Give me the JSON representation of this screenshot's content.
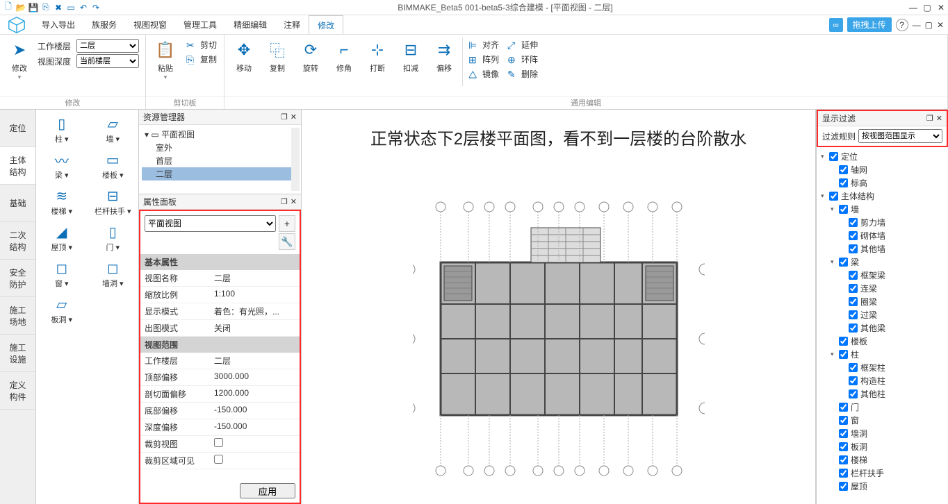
{
  "title": "BIMMAKE_Beta5 001-beta5-3综合建模 - [平面视图 - 二层]",
  "menus": [
    "导入导出",
    "族服务",
    "视图视窗",
    "管理工具",
    "精细编辑",
    "注释",
    "修改"
  ],
  "active_menu": "修改",
  "upload_label": "拖拽上传",
  "ribbon": {
    "modify": {
      "label": "修改",
      "tool": "修改",
      "work_floor_label": "工作楼层",
      "work_floor_value": "二层",
      "view_depth_label": "视图深度",
      "view_depth_value": "当前楼层"
    },
    "clipboard": {
      "label": "剪切板",
      "paste": "粘贴",
      "cut": "剪切",
      "copy": "复制"
    },
    "edit": {
      "label": "通用编辑",
      "move": "移动",
      "copy2": "复制",
      "rotate": "旋转",
      "corner": "修角",
      "break": "打断",
      "trim": "扣减",
      "offset": "偏移",
      "align": "对齐",
      "array": "阵列",
      "mirror": "镜像",
      "extend": "延伸",
      "ring": "环阵",
      "delete": "删除"
    }
  },
  "left_tabs": [
    "定位",
    "主体\n结构",
    "基础",
    "二次\n结构",
    "安全\n防护",
    "施工\n场地",
    "施工\n设施",
    "定义\n构件"
  ],
  "active_left_tab": 1,
  "palette": [
    {
      "icon": "▯",
      "label": "柱"
    },
    {
      "icon": "▱",
      "label": "墙"
    },
    {
      "icon": "〰",
      "label": "梁"
    },
    {
      "icon": "▭",
      "label": "楼板"
    },
    {
      "icon": "≋",
      "label": "楼梯"
    },
    {
      "icon": "⊟",
      "label": "栏杆扶手"
    },
    {
      "icon": "◢",
      "label": "屋顶"
    },
    {
      "icon": "▯",
      "label": "门"
    },
    {
      "icon": "◻",
      "label": "窗"
    },
    {
      "icon": "◻",
      "label": "墙洞"
    },
    {
      "icon": "▱",
      "label": "板洞"
    },
    {
      "icon": "",
      "label": ""
    }
  ],
  "browser": {
    "title": "资源管理器",
    "root": "平面视图",
    "items": [
      "室外",
      "首层",
      "二层"
    ],
    "selected": "二层"
  },
  "props": {
    "title": "属性面板",
    "type": "平面视图",
    "basic_label": "基本属性",
    "basic": [
      {
        "k": "视图名称",
        "v": "二层"
      },
      {
        "k": "缩放比例",
        "v": "1:100"
      },
      {
        "k": "显示模式",
        "v": "着色：有光照，..."
      },
      {
        "k": "出图模式",
        "v": "关闭"
      }
    ],
    "range_label": "视图范围",
    "range": [
      {
        "k": "工作楼层",
        "v": "二层"
      },
      {
        "k": "顶部偏移",
        "v": "3000.000"
      },
      {
        "k": "剖切面偏移",
        "v": "1200.000"
      },
      {
        "k": "底部偏移",
        "v": "-150.000"
      },
      {
        "k": "深度偏移",
        "v": "-150.000"
      },
      {
        "k": "裁剪视图",
        "v": "",
        "cb": true
      },
      {
        "k": "裁剪区域可见",
        "v": "",
        "cb": true
      }
    ],
    "apply": "应用"
  },
  "annotation": "正常状态下2层楼平面图，看不到一层楼的台阶散水",
  "filter": {
    "title": "显示过滤",
    "rule_label": "过滤规则",
    "rule_value": "按视图范围显示",
    "tree": [
      {
        "d": 0,
        "a": "▾",
        "t": "定位"
      },
      {
        "d": 1,
        "t": "轴网"
      },
      {
        "d": 1,
        "t": "标高"
      },
      {
        "d": 0,
        "a": "▾",
        "t": "主体结构"
      },
      {
        "d": 1,
        "a": "▾",
        "t": "墙"
      },
      {
        "d": 2,
        "t": "剪力墙"
      },
      {
        "d": 2,
        "t": "砌体墙"
      },
      {
        "d": 2,
        "t": "其他墙"
      },
      {
        "d": 1,
        "a": "▾",
        "t": "梁"
      },
      {
        "d": 2,
        "t": "框架梁"
      },
      {
        "d": 2,
        "t": "连梁"
      },
      {
        "d": 2,
        "t": "圈梁"
      },
      {
        "d": 2,
        "t": "过梁"
      },
      {
        "d": 2,
        "t": "其他梁"
      },
      {
        "d": 1,
        "t": "楼板"
      },
      {
        "d": 1,
        "a": "▾",
        "t": "柱"
      },
      {
        "d": 2,
        "t": "框架柱"
      },
      {
        "d": 2,
        "t": "构造柱"
      },
      {
        "d": 2,
        "t": "其他柱"
      },
      {
        "d": 1,
        "t": "门"
      },
      {
        "d": 1,
        "t": "窗"
      },
      {
        "d": 1,
        "t": "墙洞"
      },
      {
        "d": 1,
        "t": "板洞"
      },
      {
        "d": 1,
        "t": "楼梯"
      },
      {
        "d": 1,
        "t": "栏杆扶手"
      },
      {
        "d": 1,
        "t": "屋顶"
      }
    ]
  }
}
